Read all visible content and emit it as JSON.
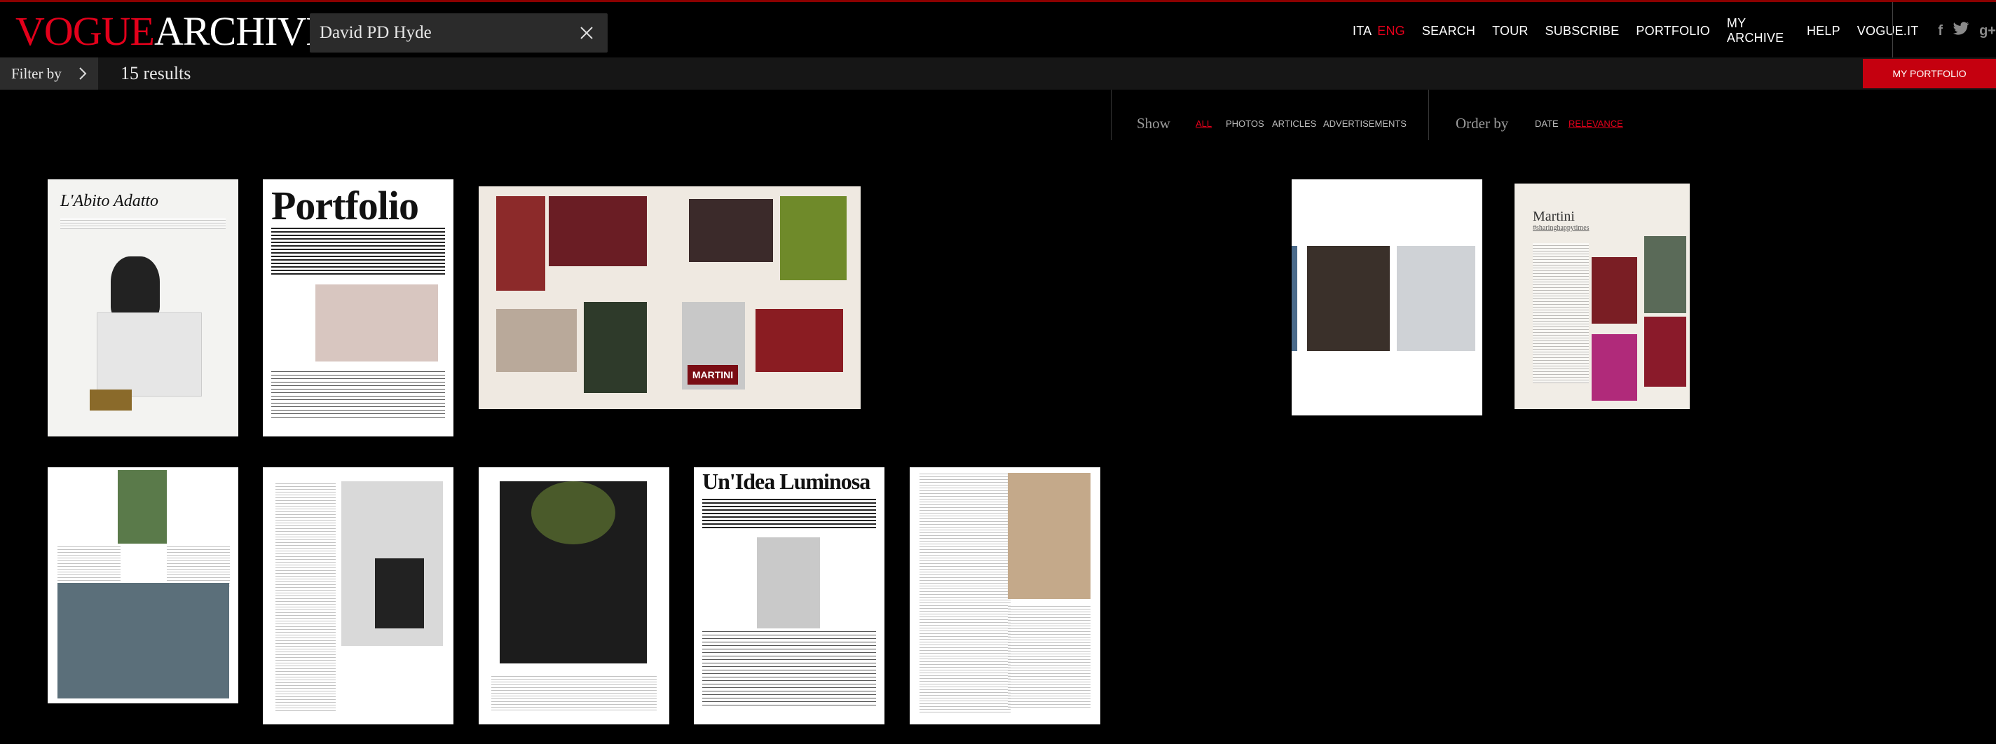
{
  "logo": {
    "vogue": "VOGUE",
    "archive": "ARCHIVE"
  },
  "search": {
    "value": "David PD Hyde",
    "clear_icon": "close-icon"
  },
  "nav": {
    "ita": "ITA",
    "eng": "ENG",
    "search": "SEARCH",
    "tour": "TOUR",
    "subscribe": "SUBSCRIBE",
    "portfolio": "PORTFOLIO",
    "my_archive": "MY ARCHIVE",
    "help": "HELP",
    "vogue_it": "VOGUE.IT",
    "social": {
      "facebook": "f",
      "twitter": "🐦",
      "gplus": "g+"
    }
  },
  "subbar": {
    "filter_label": "Filter by",
    "results": "15 results",
    "my_portfolio": "MY PORTFOLIO"
  },
  "show": {
    "label": "Show",
    "options": [
      "ALL",
      "PHOTOS",
      "ARTICLES",
      "ADVERTISEMENTS"
    ],
    "selected": "ALL"
  },
  "order": {
    "label": "Order by",
    "options": [
      "DATE",
      "RELEVANCE"
    ],
    "selected": "RELEVANCE"
  },
  "thumbs": {
    "t1_title": "L'Abito Adatto",
    "t2_title": "Portfolio",
    "t3_label": "MARTINI",
    "t5_title": "Martini",
    "t5_sub": "#sharinghappytimes",
    "t9_title": "Un'Idea Luminosa"
  },
  "colors": {
    "brand_red": "#e3001b",
    "button_red": "#c5000f",
    "bar": "#161616"
  }
}
